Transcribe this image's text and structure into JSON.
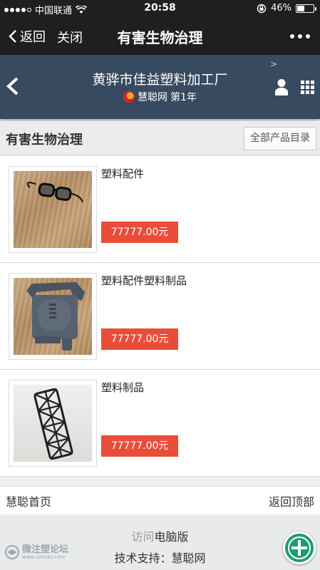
{
  "status_bar": {
    "carrier": "中国联通",
    "time": "20:58",
    "battery": "46%",
    "battery_level": 0.46,
    "signal_bars": 4
  },
  "wechat_nav": {
    "back_label": "返回",
    "close_label": "关闭",
    "title": "有害生物治理"
  },
  "site_header": {
    "company": "黄骅市佳益塑料加工厂",
    "platform": "慧聪网",
    "membership_years": "第1年",
    "corner_mark": ">"
  },
  "section": {
    "title": "有害生物治理",
    "catalog_button": "全部产品目录"
  },
  "products": [
    {
      "name": "塑料配件",
      "price": "77777.00元",
      "image": "glasses-photo"
    },
    {
      "name": "塑料配件塑料制品",
      "price": "77777.00元",
      "image": "plastic-housing-photo"
    },
    {
      "name": "塑料制品",
      "price": "77777.00元",
      "image": "lattice-tube-photo"
    }
  ],
  "footer_nav": {
    "home_label": "慧聪首页",
    "top_label": "返回顶部"
  },
  "footer": {
    "visit_prefix": "访问",
    "pc_version": "电脑版",
    "support": "技术支持：慧聪网"
  },
  "watermark": {
    "text": "微注塑论坛",
    "url": "www.vzhusu.com"
  },
  "colors": {
    "header_bg": "#384a60",
    "price_bg": "#e94d3a",
    "fab_bg": "#1e9e70"
  }
}
